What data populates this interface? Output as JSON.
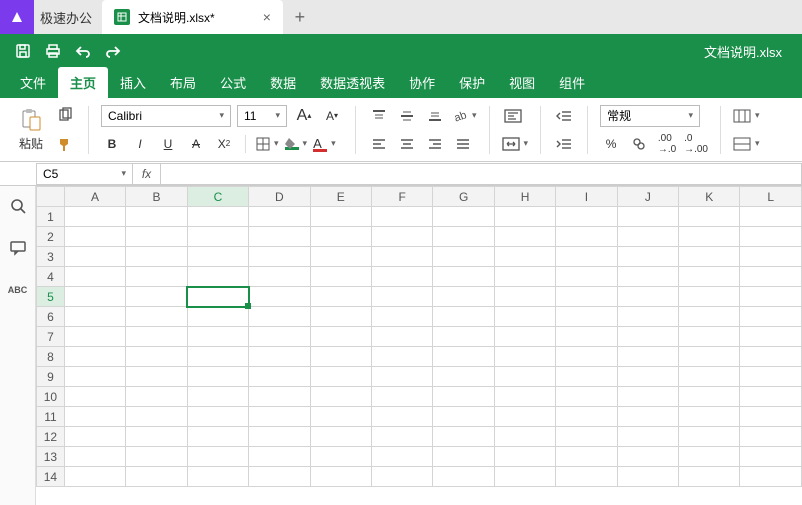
{
  "app": {
    "name": "极速办公"
  },
  "tab": {
    "title": "文档说明.xlsx*"
  },
  "doc_title": "文档说明.xlsx",
  "menu": {
    "file": "文件",
    "home": "主页",
    "insert": "插入",
    "layout": "布局",
    "formula": "公式",
    "data": "数据",
    "pivot": "数据透视表",
    "collab": "协作",
    "protect": "保护",
    "view": "视图",
    "component": "组件"
  },
  "ribbon": {
    "paste": "粘贴",
    "font_name": "Calibri",
    "font_size": "11",
    "increase_font": "A",
    "decrease_font": "A",
    "number_format": "常规"
  },
  "namebox": "C5",
  "fx": "fx",
  "cols": [
    "A",
    "B",
    "C",
    "D",
    "E",
    "F",
    "G",
    "H",
    "I",
    "J",
    "K",
    "L"
  ],
  "rows": [
    "1",
    "2",
    "3",
    "4",
    "5",
    "6",
    "7",
    "8",
    "9",
    "10",
    "11",
    "12",
    "13",
    "14"
  ],
  "selected": {
    "col": "C",
    "row": "5"
  },
  "side": {
    "spell": "ABC"
  }
}
